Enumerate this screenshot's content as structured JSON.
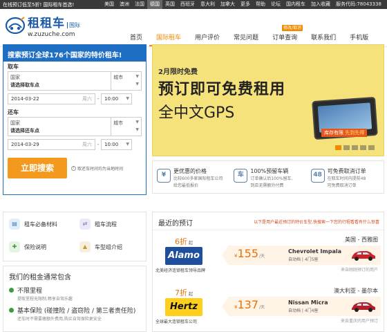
{
  "topbar": {
    "promo_prefix": "在线预订低至5折!",
    "promo_highlight": "国际租车首选!",
    "links": [
      "美国",
      "澳洲",
      "法国",
      "德国",
      "英国",
      "西班牙",
      "意大利",
      "加拿大",
      "更多",
      "帮助",
      "论坛",
      "国内租车",
      "加入收藏",
      "服务代码:78043338"
    ],
    "active_link_index": 3
  },
  "logo": {
    "name": "租租车",
    "badge": "国际",
    "url": "w.zuzuche.com"
  },
  "nav": {
    "items": [
      "首页",
      "国际租车",
      "用户评价",
      "常见问题",
      "订单查询",
      "联系我们",
      "手机版"
    ],
    "active_index": 1,
    "order_badge": "修改/取消"
  },
  "booking": {
    "header": "搜索预订全球176个国家的特价租车!",
    "pickup": {
      "label": "取车",
      "country_label": "国家",
      "city_label": "城市",
      "location_placeholder": "请选择取车点",
      "date": "2014-03-22",
      "weekday": "周六",
      "time": "10:00"
    },
    "dropoff": {
      "label": "还车",
      "country_label": "国家",
      "city_label": "城市",
      "location_placeholder": "请选择还车点",
      "date": "2014-03-29",
      "weekday": "周六",
      "time": "10:00"
    },
    "search_button": "立即搜索",
    "search_note": "取还车时间均为当地时间"
  },
  "banner": {
    "line1": "2月限时免费",
    "line2": "预订即可免费租用",
    "line3": "全中文GPS",
    "stock_text": "库存有限",
    "stock_highlight": "先到先得",
    "slide_count": 5,
    "active_slide": 0
  },
  "features": [
    {
      "icon": "yen-icon",
      "glyph": "¥",
      "title": "更优惠的价格",
      "desc1": "比较600多家国际租车公司",
      "desc2": "给您最低报价"
    },
    {
      "icon": "car-icon",
      "glyph": "车",
      "title": "100%预留车辆",
      "desc1": "订单确认后100%留车,",
      "desc2": "到店无需额外付费"
    },
    {
      "icon": "clock-icon",
      "glyph": "48",
      "title": "可免费取消订单",
      "desc1": "在取车时间内提前48",
      "desc2": "可免费取消订单"
    }
  ],
  "tools": [
    {
      "icon": "document-icon",
      "label": "租车必备材料",
      "color": "#3a7cc4",
      "bg": "#e3eef9",
      "glyph": "▤"
    },
    {
      "icon": "flow-icon",
      "label": "租车流程",
      "color": "#7b6fc2",
      "bg": "#ebe8f7",
      "glyph": "⇄"
    },
    {
      "icon": "insurance-icon",
      "label": "保险说明",
      "color": "#3c9b3c",
      "bg": "#e5f3e5",
      "glyph": "✚"
    },
    {
      "icon": "car-group-icon",
      "label": "车型组介绍",
      "color": "#c49a2e",
      "bg": "#f7efdc",
      "glyph": "▲"
    }
  ],
  "package": {
    "title": "我们的租金通常包含",
    "items": [
      {
        "title": "不限里程",
        "desc": "提取里程无限制,畅享自驾乐趣"
      },
      {
        "title": "基本保险 (碰撞险 / 盗窃险 / 第三者责任险)",
        "desc": "还车时不需要缴额外费用,购买自驾保险更安全"
      }
    ]
  },
  "recent": {
    "title": "最近的预订",
    "notice": "以下是用户最近预订的特价车型,快搜索一下您的行程看看有什么惊喜",
    "rows": [
      {
        "discount": "6折",
        "discount_suffix": "起",
        "brand": "Alamo",
        "brand_color": "#1f4e9c",
        "brand_text_color": "#ffffff",
        "brand_desc": "北美经济连锁租车领导品牌",
        "route": "美国 - 西雅图",
        "price": "155",
        "currency": "¥",
        "per": "/天",
        "car": "Chevrolet Impala",
        "car_info": "自动档 | 4门5座",
        "from": "来自刚刚预订的用户",
        "car_color": "#c8242c"
      },
      {
        "discount": "7折",
        "discount_suffix": "起",
        "brand": "Hertz",
        "brand_color": "#ffcf1e",
        "brand_text_color": "#111111",
        "brand_desc": "全球最大连锁租车公司",
        "route": "澳大利亚 - 墨尔本",
        "price": "137",
        "currency": "¥",
        "per": "/天",
        "car": "Nissan Micra",
        "car_info": "自动档 | 4门4座",
        "from": "来自重庆的用户预订",
        "car_color": "#b31f2a"
      }
    ]
  }
}
